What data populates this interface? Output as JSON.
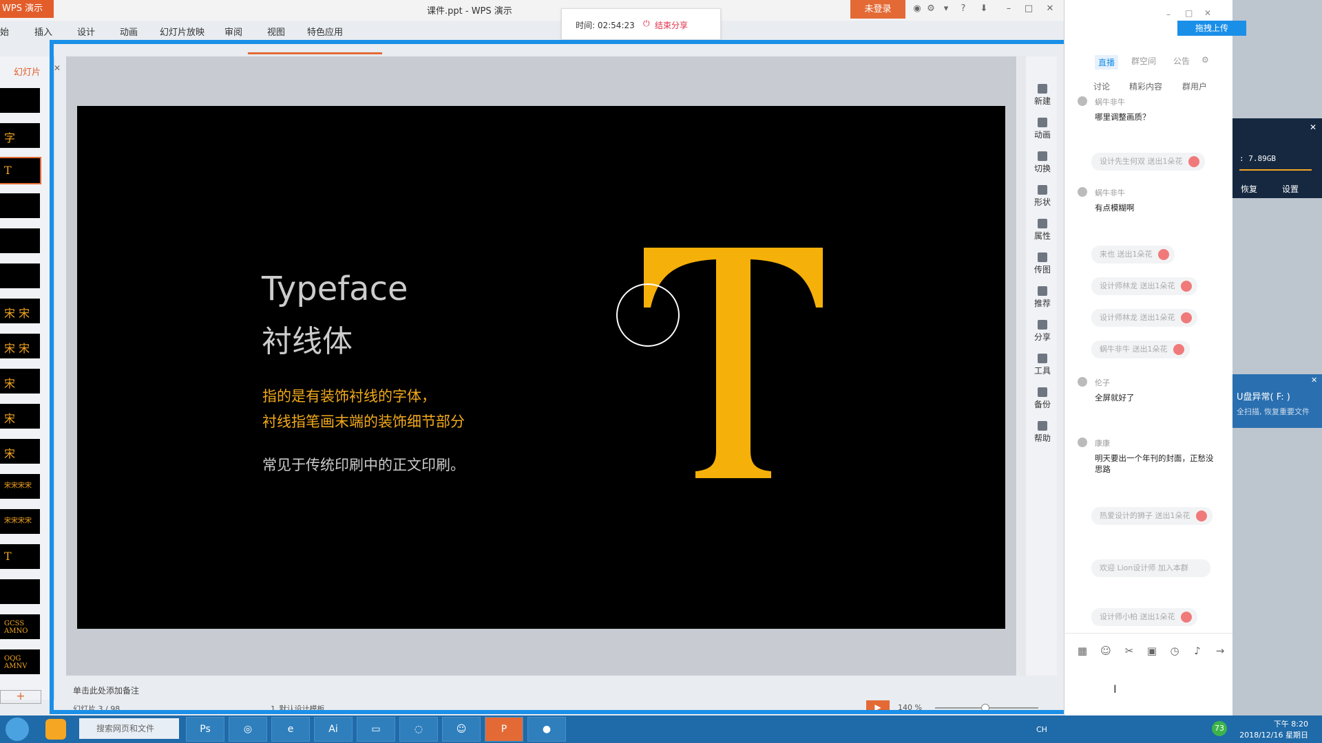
{
  "app": {
    "menu_btn": "WPS 演示",
    "title": "课件.ppt - WPS 演示",
    "login": "未登录",
    "menu": [
      "始",
      "插入",
      "设计",
      "动画",
      "幻灯片放映",
      "审阅",
      "视图",
      "特色应用"
    ]
  },
  "share": {
    "timer": "时间: 02:54:23",
    "end": "结束分享"
  },
  "left_panel": {
    "title": "幻灯片",
    "thumbs": [
      "",
      "字",
      "T",
      "",
      "",
      "",
      "宋 宋",
      "宋 宋",
      "宋",
      "宋",
      "宋",
      "宋宋宋宋",
      "宋宋宋宋",
      "T",
      "",
      "GCSS AMNO",
      "OQG AMNV"
    ]
  },
  "slide": {
    "title_en": "Typeface",
    "title_cn": "衬线体",
    "line1": "指的是有装饰衬线的字体，",
    "line2": "衬线指笔画末端的装饰细节部分",
    "line3": "常见于传统印刷中的正文印刷。",
    "big_letter": "T"
  },
  "right_tools": [
    "新建",
    "动画",
    "切换",
    "形状",
    "属性",
    "传图",
    "推荐",
    "分享",
    "工具",
    "备份",
    "帮助"
  ],
  "notes_placeholder": "单击此处添加备注",
  "status": {
    "slide_no": "幻灯片 3 / 98",
    "template": "1_默认设计模板",
    "zoom": "140 %"
  },
  "chat": {
    "tabs": [
      "直播",
      "群空间",
      "公告"
    ],
    "subtabs": [
      "讨论",
      "精彩内容",
      "群用户"
    ],
    "items": [
      {
        "type": "msg",
        "user": "蜗牛非牛",
        "text": "哪里调整画质？"
      },
      {
        "type": "gift",
        "text": "设计先生何双 送出1朵花"
      },
      {
        "type": "msg",
        "user": "蜗牛非牛",
        "text": "有点模糊啊"
      },
      {
        "type": "gift",
        "text": "来也 送出1朵花"
      },
      {
        "type": "gift",
        "text": "设计师林龙 送出1朵花"
      },
      {
        "type": "gift",
        "text": "设计师林龙 送出1朵花"
      },
      {
        "type": "gift",
        "text": "蜗牛非牛 送出1朵花"
      },
      {
        "type": "msg",
        "user": "伦子",
        "text": "全屏就好了"
      },
      {
        "type": "msg",
        "user": "康康",
        "text": "明天要出一个年刊的封面，正愁没思路"
      },
      {
        "type": "gift",
        "text": "热爱设计的狮子 送出1朵花"
      },
      {
        "type": "gift",
        "text": "欢迎 Lion设计师 加入本群"
      },
      {
        "type": "gift",
        "text": "设计师小柏 送出1朵花"
      }
    ]
  },
  "desktop": {
    "upload": "拖拽上传",
    "size": ": 7.89GB",
    "restore": "恢复",
    "settings": "设置",
    "usb_title": "U盘异常( F: )",
    "usb_sub": "全扫描, 恢复重要文件"
  },
  "taskbar": {
    "search": "搜索网页和文件",
    "ime": "CH",
    "battery": "73",
    "time": "下午 8:20",
    "date": "2018/12/16 星期日"
  }
}
